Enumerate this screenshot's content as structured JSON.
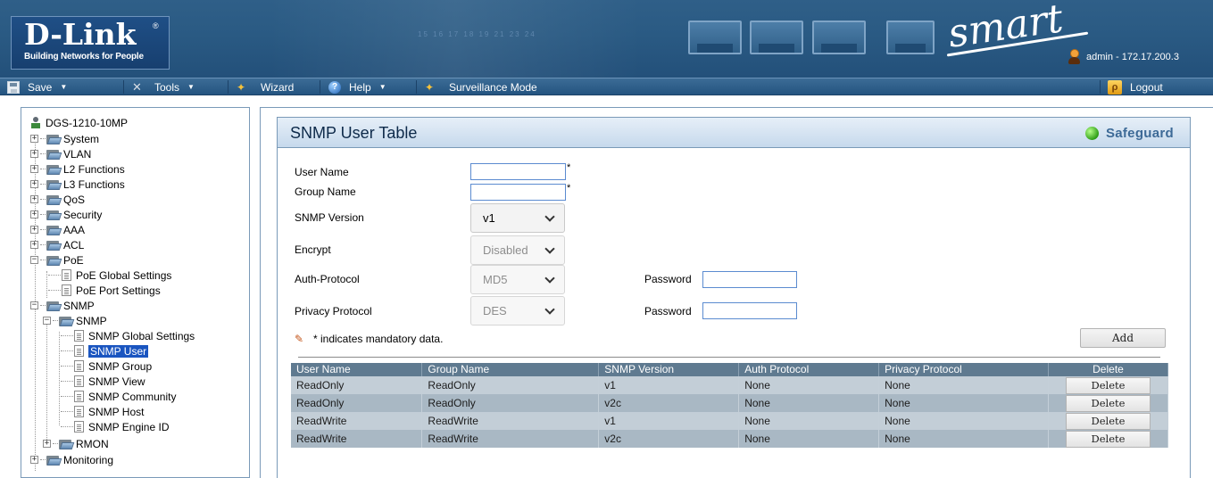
{
  "banner": {
    "brand": "D-Link",
    "registered": "®",
    "tagline": "Building Networks for People",
    "smart_logo": "smart",
    "user_session": "admin - 172.17.200.3",
    "port_numbers": "15 16 17 18 19 21 23 24"
  },
  "menu": {
    "save": "Save",
    "tools": "Tools",
    "wizard": "Wizard",
    "help": "Help",
    "surveillance": "Surveillance Mode",
    "logout": "Logout"
  },
  "tree": {
    "root": "DGS-1210-10MP",
    "system": "System",
    "vlan": "VLAN",
    "l2": "L2 Functions",
    "l3": "L3 Functions",
    "qos": "QoS",
    "security": "Security",
    "aaa": "AAA",
    "acl": "ACL",
    "poe": "PoE",
    "poe_global": "PoE Global Settings",
    "poe_port": "PoE Port Settings",
    "snmp": "SNMP",
    "snmp_sub": "SNMP",
    "snmp_global": "SNMP Global Settings",
    "snmp_user": "SNMP User",
    "snmp_group": "SNMP Group",
    "snmp_view": "SNMP View",
    "snmp_community": "SNMP Community",
    "snmp_host": "SNMP Host",
    "snmp_engine": "SNMP Engine ID",
    "rmon": "RMON",
    "monitoring": "Monitoring"
  },
  "panel": {
    "title": "SNMP User Table",
    "safeguard": "Safeguard"
  },
  "form": {
    "user_name_label": "User Name",
    "user_name_value": "",
    "group_name_label": "Group Name",
    "group_name_value": "",
    "required_mark": "*",
    "snmp_version_label": "SNMP Version",
    "snmp_version_value": "v1",
    "encrypt_label": "Encrypt",
    "encrypt_value": "Disabled",
    "auth_protocol_label": "Auth-Protocol",
    "auth_protocol_value": "MD5",
    "privacy_protocol_label": "Privacy Protocol",
    "privacy_protocol_value": "DES",
    "password_label": "Password",
    "auth_password_value": "",
    "privacy_password_value": "",
    "mandatory_note": "* indicates mandatory data.",
    "add_button": "Add"
  },
  "table": {
    "headers": [
      "User Name",
      "Group Name",
      "SNMP Version",
      "Auth Protocol",
      "Privacy Protocol",
      "Delete"
    ],
    "rows": [
      [
        "ReadOnly",
        "ReadOnly",
        "v1",
        "None",
        "None"
      ],
      [
        "ReadOnly",
        "ReadOnly",
        "v2c",
        "None",
        "None"
      ],
      [
        "ReadWrite",
        "ReadWrite",
        "v1",
        "None",
        "None"
      ],
      [
        "ReadWrite",
        "ReadWrite",
        "v2c",
        "None",
        "None"
      ]
    ],
    "delete_label": "Delete"
  },
  "colors": {
    "banner_blue": "#2a5a83",
    "table_header": "#5f7a90",
    "row_light": "#c3ced7",
    "row_dark": "#a9b8c4",
    "selected_tree": "#1a55c0",
    "safeguard_green": "#2f9e17"
  }
}
